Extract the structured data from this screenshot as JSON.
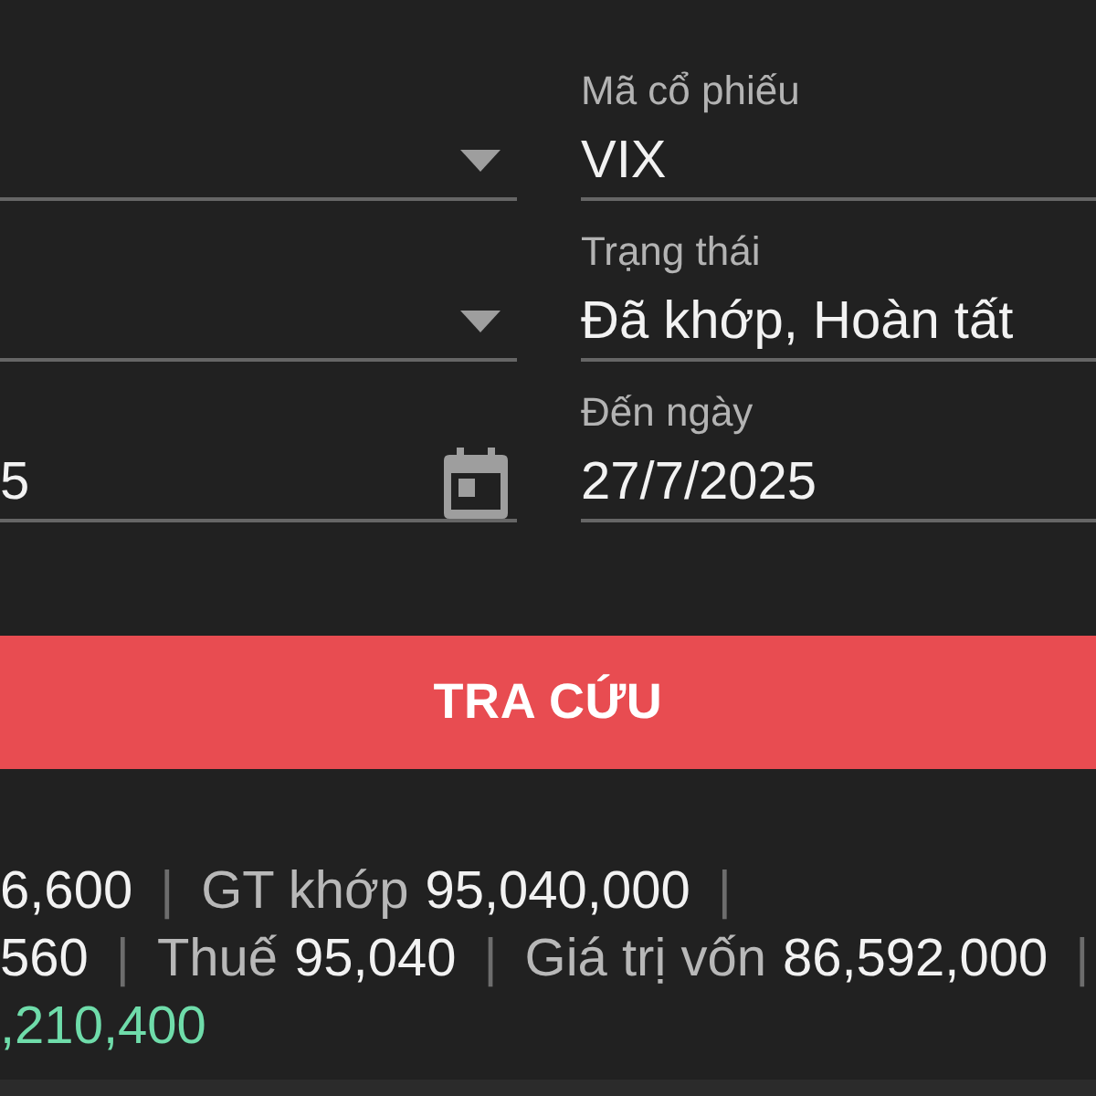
{
  "filters": [
    {
      "kind": "dropdown"
    },
    {
      "kind": "text",
      "label": "Mã cổ phiếu",
      "value": "VIX"
    },
    {
      "kind": "dropdown"
    },
    {
      "kind": "text",
      "label": "Trạng thái",
      "value": "Đã khớp, Hoàn tất"
    },
    {
      "kind": "date",
      "value": "5"
    },
    {
      "kind": "text",
      "label": "Đến ngày",
      "value": "27/7/2025"
    }
  ],
  "search_button": {
    "label": "TRA CỨU"
  },
  "summary": [
    {
      "items": [
        {
          "kind": "value",
          "text": "6,600"
        },
        {
          "kind": "separator",
          "text": "|"
        },
        {
          "kind": "label",
          "text": "GT khớp"
        },
        {
          "kind": "value",
          "text": "95,040,000"
        },
        {
          "kind": "separator",
          "text": "|"
        }
      ]
    },
    {
      "items": [
        {
          "kind": "value",
          "text": "560"
        },
        {
          "kind": "separator",
          "text": "|"
        },
        {
          "kind": "label",
          "text": "Thuế"
        },
        {
          "kind": "value",
          "text": "95,040"
        },
        {
          "kind": "separator",
          "text": "|"
        },
        {
          "kind": "label",
          "text": "Giá trị vốn"
        },
        {
          "kind": "value",
          "text": "86,592,000"
        },
        {
          "kind": "separator",
          "text": "|"
        }
      ]
    },
    {
      "items": [
        {
          "kind": "positive",
          "text": ",210,400"
        }
      ]
    }
  ]
}
